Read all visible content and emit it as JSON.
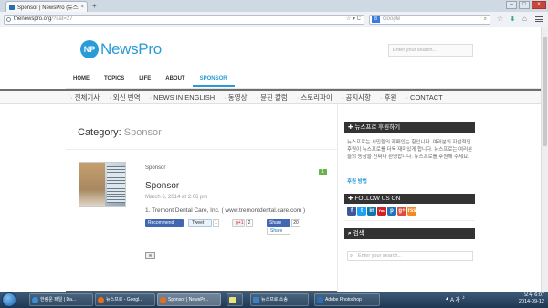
{
  "browser": {
    "tab_title": "Sponsor | NewsPro (뉴스...",
    "tab_close": "×",
    "new_tab": "+",
    "url_domain": "thenewspro.org",
    "url_path": "/?cat=27",
    "url_arrows": "☆ ▾ C",
    "search_engine_badge": "8",
    "search_placeholder": "Google",
    "search_icon": "search-icon",
    "min": "–",
    "max": "□",
    "close": "×"
  },
  "site": {
    "logo_mark": "NP",
    "logo_text": "NewsPro",
    "search_placeholder": "Enter your search...",
    "main_nav": [
      "HOME",
      "TOPICS",
      "LIFE",
      "ABOUT",
      "SPONSOR"
    ],
    "sub_nav": [
      "전체기사",
      "외신 번역",
      "NEWS IN ENGLISH",
      "동영상",
      "뮨진 칼럼",
      "스토리파이",
      "공지사항",
      "후원",
      "CONTACT"
    ]
  },
  "category": {
    "label": "Category:",
    "name": "Sponsor"
  },
  "post": {
    "category": "Sponsor",
    "title": "Sponsor",
    "date": "March 6, 2014 at 2:06 pm",
    "comments": "1",
    "excerpt": "1. Tremont Dental Care, Inc. ( www.tremontdental.care.com )",
    "share": {
      "fb_recommend": "Recommend",
      "tweet": "Tweet",
      "tweet_count": "1",
      "gplus": "g+1",
      "gplus_count": "2",
      "fb_share": "Share",
      "fb_share_count": "20",
      "linkedin": "Share",
      "email": "✉"
    }
  },
  "sidebar": {
    "donate_heading": "뉴스프로 후원하기",
    "donate_text": "뉴스프로는 시민들의 재매인는 힘입니다. 여러분의 자발적인 후원이 뉴스프로를 더욱 재미있게 합니다. 뉴스프로는 여러분들의 동참을 진짜나 환영합니다. 뉴스프로를 후원해 주세요.",
    "donate_link": "후원 방법",
    "follow_heading": "FOLLOW US ON",
    "social": [
      "f",
      "t",
      "in",
      "You",
      "p",
      "g+",
      "rss"
    ],
    "search_heading": "검색",
    "search_placeholder": "Enter your search..."
  },
  "taskbar": {
    "items": [
      "한림운 패일 | Da...",
      "뉴스프로 - Googl...",
      "Sponsor | NewsPr...",
      "",
      "뉴스프로 소송",
      "Adobe Photoshop"
    ],
    "time": "오후 6:07",
    "date": "2014-09-12",
    "lang": "A 가"
  },
  "colors": {
    "brand": "#2a9bd6",
    "header_dark": "#333333"
  }
}
